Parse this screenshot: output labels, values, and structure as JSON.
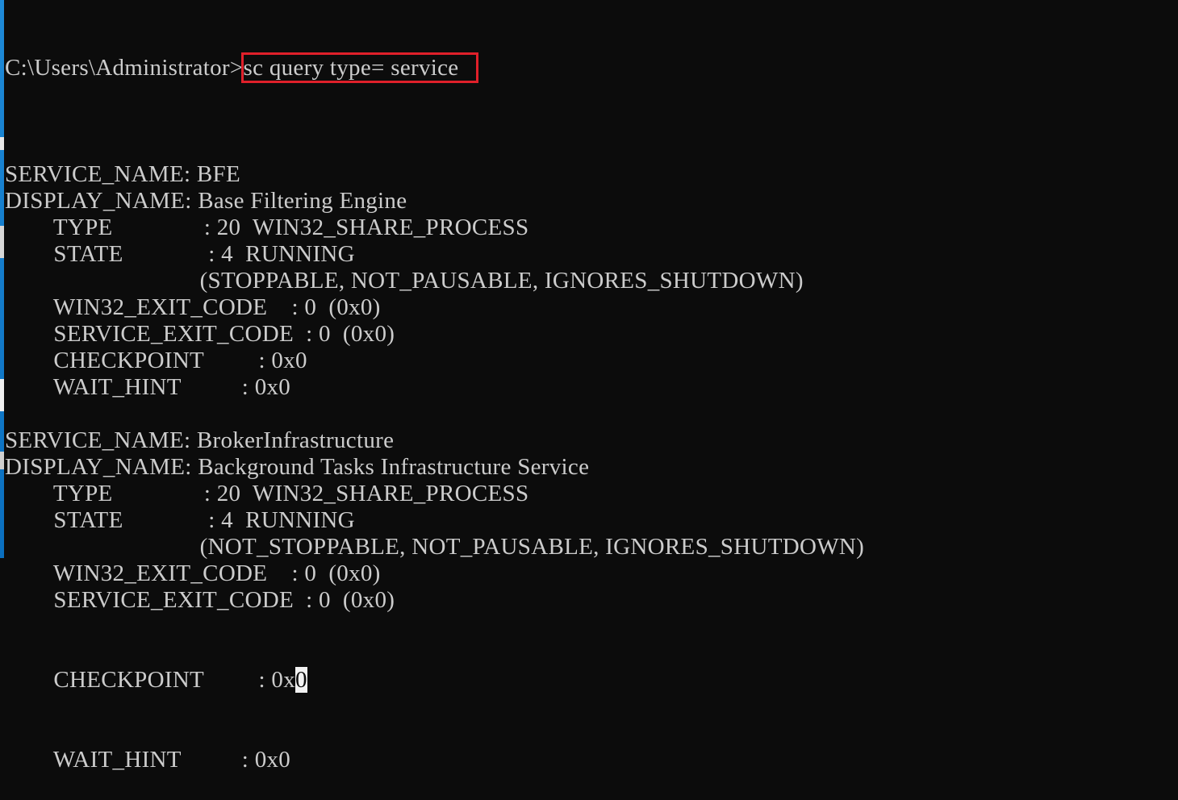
{
  "terminal": {
    "prompt": "C:\\Users\\Administrator>",
    "command": "sc query type= service",
    "lines": [
      "",
      "SERVICE_NAME: BFE",
      "DISPLAY_NAME: Base Filtering Engine",
      "        TYPE               : 20  WIN32_SHARE_PROCESS",
      "        STATE              : 4  RUNNING",
      "                                (STOPPABLE, NOT_PAUSABLE, IGNORES_SHUTDOWN)",
      "        WIN32_EXIT_CODE    : 0  (0x0)",
      "        SERVICE_EXIT_CODE  : 0  (0x0)",
      "        CHECKPOINT         : 0x0",
      "        WAIT_HINT          : 0x0",
      "",
      "SERVICE_NAME: BrokerInfrastructure",
      "DISPLAY_NAME: Background Tasks Infrastructure Service",
      "        TYPE               : 20  WIN32_SHARE_PROCESS",
      "        STATE              : 4  RUNNING",
      "                                (NOT_STOPPABLE, NOT_PAUSABLE, IGNORES_SHUTDOWN)",
      "        WIN32_EXIT_CODE    : 0  (0x0)",
      "        SERVICE_EXIT_CODE  : 0  (0x0)"
    ],
    "checkpoint_prefix": "        CHECKPOINT         : 0x",
    "checkpoint_cursor_char": "0",
    "last_line": "        WAIT_HINT          : 0x0",
    "colors": {
      "background": "#0c0c0c",
      "text": "#cccccc",
      "highlight_box": "#e0202a",
      "cursor": "#f2f2f2"
    }
  }
}
